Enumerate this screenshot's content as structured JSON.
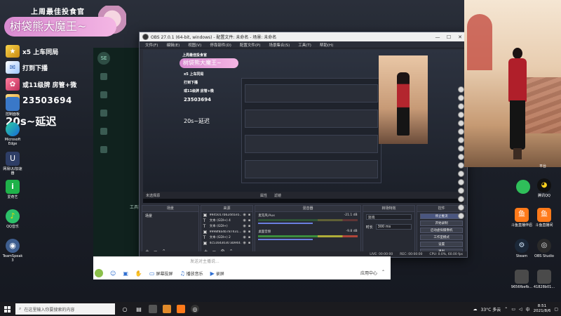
{
  "overlay": {
    "title": "上周最佳投食官",
    "streamer_name": "树袋熊大魔王~",
    "rows": [
      {
        "icon": "trophy-icon",
        "text": "x5  上车同局"
      },
      {
        "icon": "chat-icon",
        "text": "打到下播"
      },
      {
        "icon": "gift-icon",
        "text": "或11级牌 房管+微"
      },
      {
        "icon": "qq-icon",
        "text": "23503694"
      }
    ],
    "delay": "20s~延迟"
  },
  "desktop_left": [
    {
      "label": "控制面板",
      "icon": "control-panel-icon"
    },
    {
      "label": "Microsoft Edge",
      "icon": "edge-icon"
    },
    {
      "label": "网易UU加速器",
      "icon": "uu-accelerator-icon"
    },
    {
      "label": "爱奇艺",
      "icon": "iqiyi-icon"
    },
    {
      "label": "QQ音乐",
      "icon": "qq-music-icon"
    },
    {
      "label": "TeamSpeak 3",
      "icon": "teamspeak-icon"
    }
  ],
  "green_app": {
    "label": "工具箱"
  },
  "obs": {
    "title": "OBS 27.0.1 (64-bit, windows) - 配置文件: 未命名 - 场景: 未命名",
    "menu": [
      "文件(F)",
      "编辑(E)",
      "视图(V)",
      "停靠部件(D)",
      "配置文件(P)",
      "场景集合(S)",
      "工具(T)",
      "帮助(H)"
    ],
    "no_source": "未选择源",
    "properties": "属性",
    "filters": "滤镜",
    "docks": {
      "scenes": "场景",
      "sources": "来源",
      "mixer": "混音器",
      "transitions": "转场特效",
      "controls": "控件"
    },
    "scene_list": [
      "场景"
    ],
    "sources": [
      {
        "type": "image",
        "name": "9945017b62dd1e5..."
      },
      {
        "type": "text",
        "name": "文本 (GDI+) 4"
      },
      {
        "type": "text",
        "name": "文本 (GDI+)"
      },
      {
        "type": "image",
        "name": "9998f8a4b787431..."
      },
      {
        "type": "text",
        "name": "文本 (GDI+) 2"
      },
      {
        "type": "image",
        "name": "4c516d3030 ab94d..."
      }
    ],
    "mixer": [
      {
        "name": "麦克风/Aux",
        "db": "-21.1 dB"
      },
      {
        "name": "桌面音频",
        "db": "-9.8 dB"
      }
    ],
    "transition": {
      "type": "淡出",
      "duration_label": "时长",
      "duration": "300 ms"
    },
    "controls": [
      "停止推流",
      "开始录制",
      "启动虚拟摄像机",
      "工作室模式",
      "设置",
      "退出"
    ],
    "status": {
      "live": "LIVE: 00:00:00",
      "rec": "REC: 00:00:00",
      "cpu": "CPU: 0.0%, 60.00 fps"
    },
    "preview": {
      "title": "上周最佳投食官",
      "name": "树袋熊大魔王~",
      "rows": [
        "x5 上车同局",
        "打到下播",
        "或11级牌 房管+微",
        "23503694"
      ],
      "delay": "20s~延迟"
    }
  },
  "chat_bar": {
    "placeholder": "发送对主播说...",
    "tools": [
      {
        "icon": "emoji-icon",
        "label": ""
      },
      {
        "icon": "image-icon",
        "label": ""
      },
      {
        "icon": "hand-icon",
        "label": ""
      },
      {
        "icon": "screen-icon",
        "label": "屏幕投屏"
      },
      {
        "icon": "music-icon",
        "label": "播放音乐"
      },
      {
        "icon": "video-icon",
        "label": "录屏"
      }
    ],
    "right": [
      "应用中心",
      "⌃"
    ]
  },
  "desktop_right": [
    {
      "label": "平台",
      "icon": "platform-icon"
    },
    {
      "label": "腾讯QQ",
      "icon": "qq-penguin-icon"
    },
    {
      "label": "斗鱼直播伴侣",
      "icon": "douyu-icon"
    },
    {
      "label": "斗鱼直播间",
      "icon": "douyu-room-icon"
    },
    {
      "label": "Steam",
      "icon": "steam-icon"
    },
    {
      "label": "OBS Studio",
      "icon": "obs-icon"
    },
    {
      "label": "9656fbefb...",
      "icon": "image-file-icon"
    },
    {
      "label": "41828b01...",
      "icon": "image-file-icon"
    }
  ],
  "taskbar": {
    "search_placeholder": "在这里输入你要搜索的内容",
    "weather": "33°C 多云",
    "time": "8:51",
    "date": "2021/8/6"
  },
  "colors": {
    "accent_pink": "#d88ad0",
    "obs_bg": "#2b2e38",
    "coat_red": "#b01f2a"
  }
}
